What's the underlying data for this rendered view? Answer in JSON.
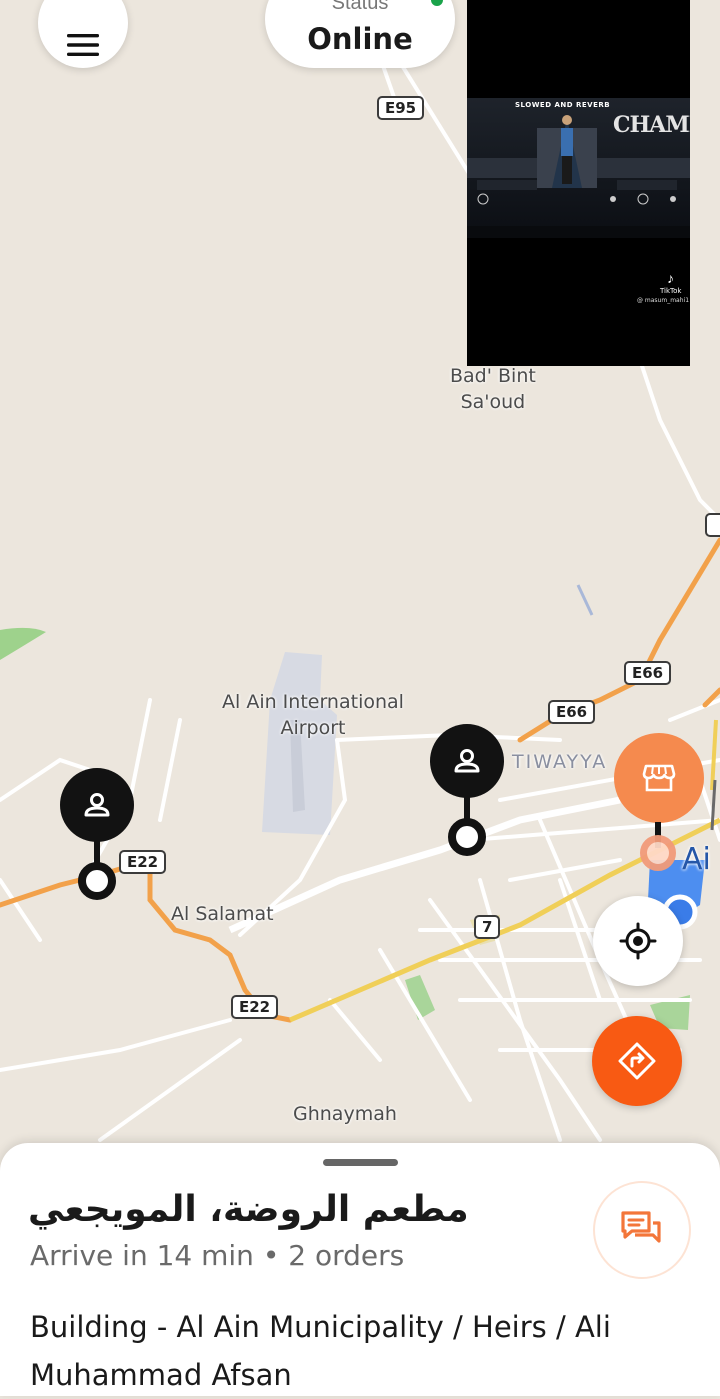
{
  "header": {
    "menu_icon": "hamburger-icon",
    "status_label": "Status",
    "status_value": "Online"
  },
  "video_overlay": {
    "tag_text": "SLOWED AND REVERB",
    "title_text": "CHAMPION",
    "brand_text": "TikTok",
    "user_text": "@ masum_mahi1"
  },
  "map": {
    "place_labels": {
      "bad_bint_saoud": "Bad' Bint\nSa'oud",
      "airport": "Al Ain International\nAirport",
      "tiwayya": "TIWAYYA",
      "al_ain": "Ai",
      "al_salamat": "Al Salamat",
      "ghnaymah": "Ghnaymah"
    },
    "road_shields": {
      "e95": "E95",
      "e66_upper": "E66",
      "e66_lower": "E66",
      "e22_left": "E22",
      "e22_lower": "E22",
      "route_7": "7"
    },
    "colors": {
      "background": "#ece6dd",
      "highway": "#f2a14a",
      "major_road": "#f0cf58",
      "minor_road": "#ffffff",
      "accent": "#f85a13",
      "store_marker": "#f58a4e"
    }
  },
  "markers": {
    "customer_icon": "person-icon",
    "store_icon": "store-icon"
  },
  "controls": {
    "locate_icon": "crosshair-icon",
    "navigate_icon": "navigate-diamond-icon"
  },
  "bottom_sheet": {
    "restaurant_name": "مطعم الروضة، المويجعي",
    "eta_text": "Arrive in 14 min • 2 orders",
    "address": "Building - Al Ain Municipality / Heirs / Ali Muhammad Afsan",
    "chat_icon": "chat-icon"
  }
}
